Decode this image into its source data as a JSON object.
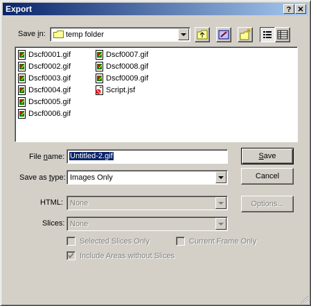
{
  "window": {
    "title": "Export",
    "help_glyph": "?",
    "close_glyph": "✕"
  },
  "save_in": {
    "label_pre": "Save ",
    "label_u": "i",
    "label_post": "n:",
    "folder": "temp folder"
  },
  "files_col1": [
    "Dscf0001.gif",
    "Dscf0002.gif",
    "Dscf0003.gif",
    "Dscf0004.gif",
    "Dscf0005.gif",
    "Dscf0006.gif"
  ],
  "files_col2": [
    "Dscf0007.gif",
    "Dscf0008.gif",
    "Dscf0009.gif",
    "Script.jsf"
  ],
  "file_name": {
    "label_pre": "File ",
    "label_u": "n",
    "label_post": "ame:",
    "value": "Untitled-2.gif"
  },
  "save_as_type": {
    "label_pre": "Save as ",
    "label_u": "t",
    "label_post": "ype:",
    "value": "Images Only"
  },
  "buttons": {
    "save_u": "S",
    "save_rest": "ave",
    "cancel": "Cancel",
    "options": "Options..."
  },
  "html": {
    "label": "HTML:",
    "value": "None"
  },
  "slices": {
    "label": "Slices:",
    "value": "None"
  },
  "checks": {
    "selected_slices": "Selected Slices Only",
    "current_frame": "Current Frame Only",
    "include_areas": "Include Areas without Slices"
  }
}
